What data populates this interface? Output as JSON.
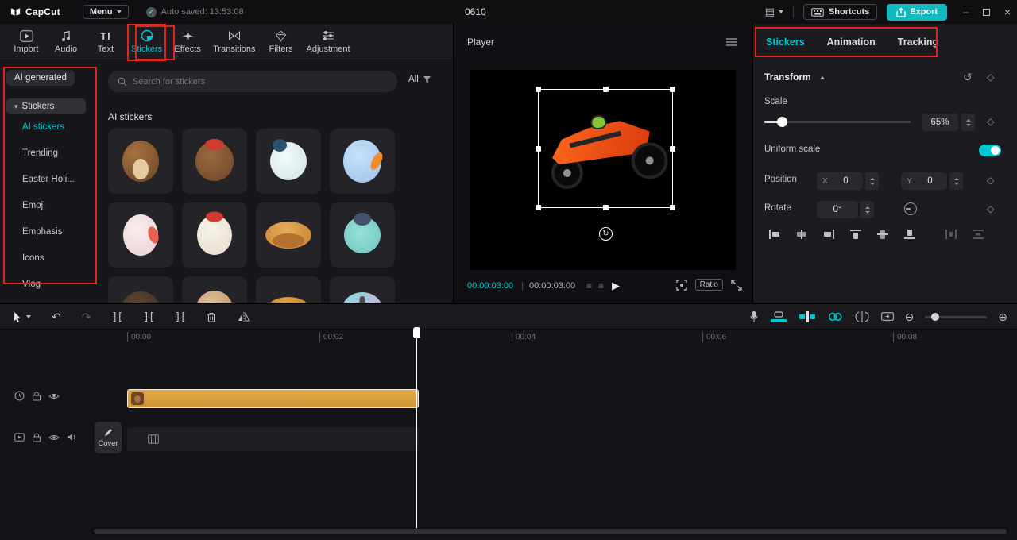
{
  "colors": {
    "accent": "#00c8d2",
    "export_button": "#10b9bf",
    "sticker_clip": "#d9a03c",
    "annotation_red": "#e0241e"
  },
  "titlebar": {
    "logo": "CapCut",
    "menu": "Menu",
    "autosave": "Auto saved: 13:53:08",
    "project": "0610",
    "shortcuts": "Shortcuts",
    "export": "Export"
  },
  "media_tabs": {
    "import": "Import",
    "audio": "Audio",
    "text": "Text",
    "stickers": "Stickers",
    "effects": "Effects",
    "transitions": "Transitions",
    "filters": "Filters",
    "adjustment": "Adjustment"
  },
  "sidebar": {
    "ai_generated": "AI generated",
    "stickers": "Stickers",
    "ai_stickers": "AI stickers",
    "trending": "Trending",
    "easter": "Easter Holi...",
    "emoji": "Emoji",
    "emphasis": "Emphasis",
    "icons": "Icons",
    "vlog": "Vlog"
  },
  "search": {
    "placeholder": "Search for stickers",
    "all": "All"
  },
  "stickers_panel": {
    "title": "AI stickers",
    "items": [
      "squirrel",
      "beaver-with-hat",
      "bird-with-scarf",
      "blue-bunny-carrot",
      "rabbit-carrot",
      "snowman-santa-hat",
      "croissant",
      "snowboard-girl",
      "dark-animal",
      "hamster",
      "bread",
      "butterfly"
    ]
  },
  "player": {
    "title": "Player",
    "time_current": "00:00:03:00",
    "time_total": "00:00:03:00",
    "ratio": "Ratio"
  },
  "inspector": {
    "tab_stickers": "Stickers",
    "tab_animation": "Animation",
    "tab_tracking": "Tracking",
    "transform": "Transform",
    "scale": "Scale",
    "scale_value": "65%",
    "uniform": "Uniform scale",
    "position": "Position",
    "x_label": "X",
    "x_value": "0",
    "y_label": "Y",
    "y_value": "0",
    "rotate": "Rotate",
    "rotate_value": "0°"
  },
  "timeline": {
    "ruler": [
      "00:00",
      "00:02",
      "00:04",
      "00:06",
      "00:08"
    ],
    "cover": "Cover"
  },
  "icons": {
    "check": "✓",
    "play": "▶",
    "undo": "↶",
    "redo": "↷",
    "rotate-handle": "↻",
    "reset": "↺",
    "zoom-in": "⊕",
    "zoom-out": "⊖",
    "keyframe-diamond": "◇",
    "caret-down": "▾",
    "layout": "▤",
    "close": "×",
    "list": "≡",
    "split": "][",
    "text-tool": "TI"
  }
}
